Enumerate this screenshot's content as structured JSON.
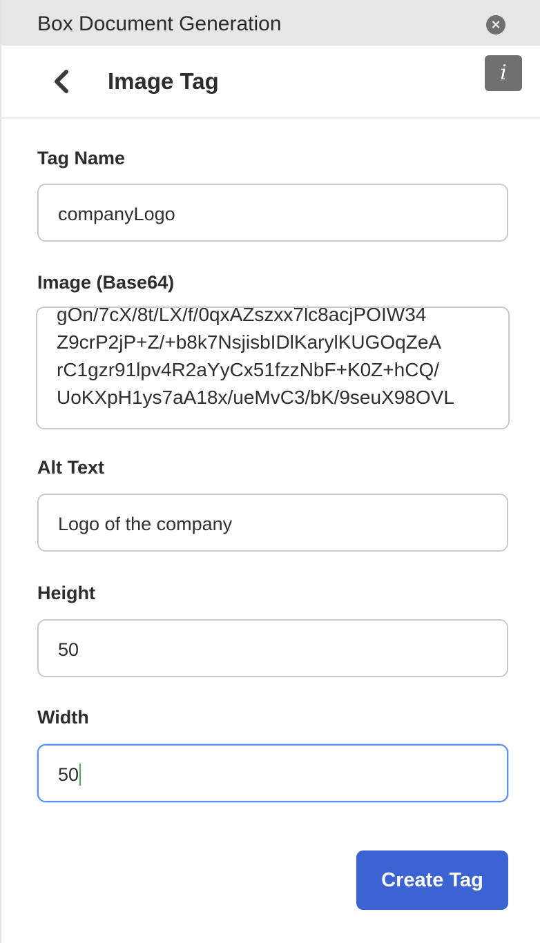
{
  "window": {
    "title": "Box Document Generation"
  },
  "header": {
    "title": "Image Tag",
    "info_icon_glyph": "i"
  },
  "form": {
    "tag_name": {
      "label": "Tag Name",
      "value": "companyLogo"
    },
    "image": {
      "label": "Image (Base64)",
      "lines": [
        "gOn/7cX/8t/LX/f/0qxAZszxx7lc8acjPOIW34",
        "Z9crP2jP+Z/+b8k7NsjisbIDlKarylKUGOqZeA",
        "rC1gzr91lpv4R2aYyCx51fzzNbF+K0Z+hCQ/",
        "UoKXpH1ys7aA18x/ueMvC3/bK/9seuX98OVL"
      ]
    },
    "alt_text": {
      "label": "Alt Text",
      "value": "Logo of the company"
    },
    "height": {
      "label": "Height",
      "value": "50"
    },
    "width": {
      "label": "Width",
      "value": "50"
    },
    "submit_label": "Create Tag"
  },
  "colors": {
    "primary": "#3b63d1",
    "focus": "#5b8ff0",
    "titlebar_bg": "#e6e6e6"
  },
  "icons": {
    "close": "close-circle-icon",
    "back": "chevron-left-icon",
    "info": "info-icon"
  }
}
